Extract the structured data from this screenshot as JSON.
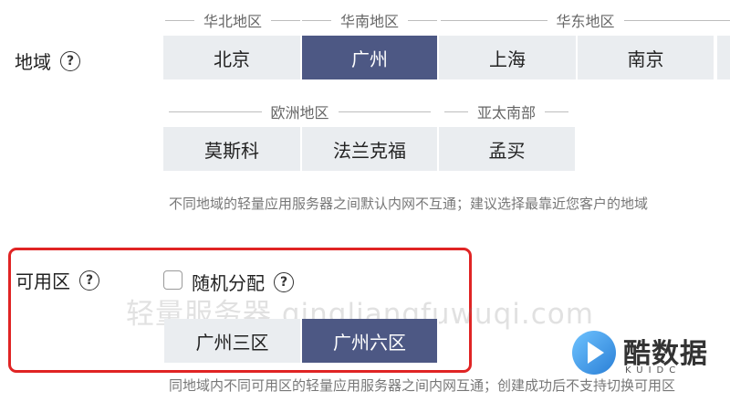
{
  "region": {
    "label": "地域",
    "help": "?",
    "groups": [
      {
        "name": "华北地区"
      },
      {
        "name": "华南地区"
      },
      {
        "name": "华东地区"
      },
      {
        "name": "欧洲地区"
      },
      {
        "name": "亚太南部"
      }
    ],
    "buttons": [
      "北京",
      "广州",
      "上海",
      "南京",
      "莫斯科",
      "法兰克福",
      "孟买"
    ],
    "selected": "广州",
    "note": "不同地域的轻量应用服务器之间默认内网不互通；建议选择最靠近您客户的地域"
  },
  "zone": {
    "label": "可用区",
    "help": "?",
    "random_label": "随机分配",
    "random_checked": false,
    "buttons": [
      "广州三区",
      "广州六区"
    ],
    "selected": "广州六区",
    "note": "同地域内不同可用区的轻量应用服务器之间内网互通；创建成功后不支持切换可用区"
  },
  "watermark": "轻量服务器 qingliangfuwuqi.com",
  "logo": {
    "name": "酷数据",
    "sub": "KUIDC"
  },
  "colors": {
    "selected": "#4d5884",
    "unselected": "#eaedf0",
    "highlight_border": "#e02424"
  }
}
